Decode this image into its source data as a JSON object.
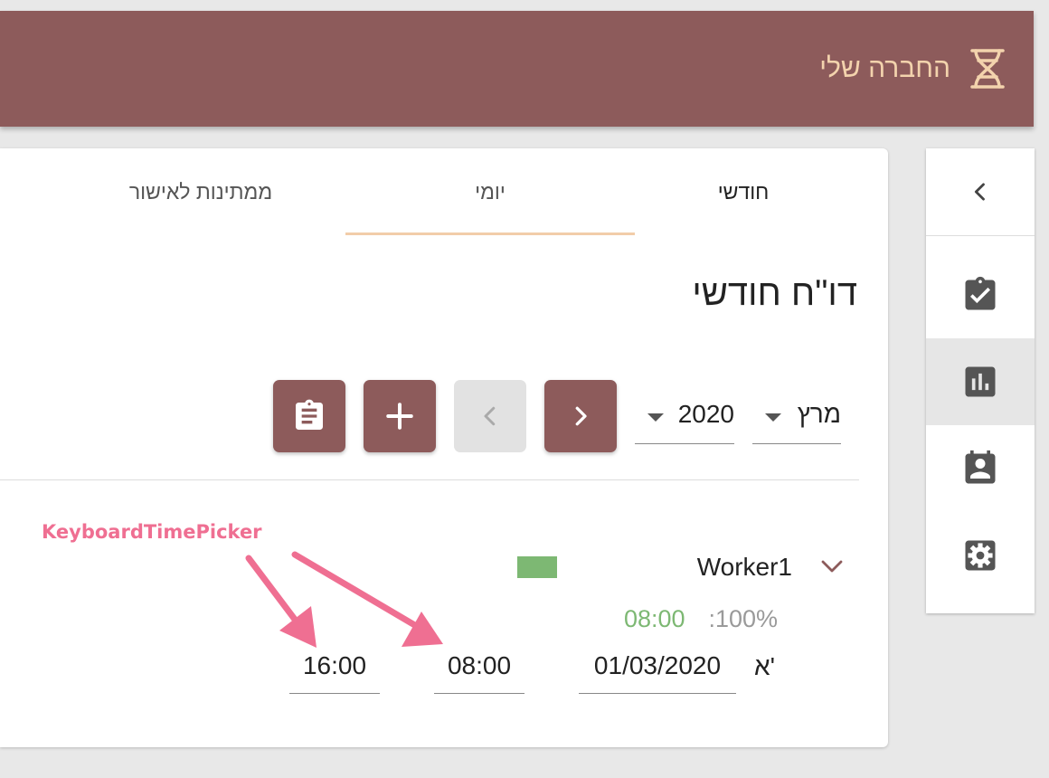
{
  "brand": {
    "title": "החברה שלי",
    "logo_icon": "dna-icon",
    "title_color": "#f3d3ad"
  },
  "appbar": {
    "color": "#8d5b5b"
  },
  "tabs": [
    {
      "label": "חודשי",
      "active": false
    },
    {
      "label": "יומי",
      "active": true
    },
    {
      "label": "ממתינות לאישור",
      "active": false
    }
  ],
  "page_title": "דו\"ח חודשי",
  "filters": {
    "month": "מרץ",
    "year": "2020"
  },
  "toolbar": {
    "next_icon": "chevron-right-icon",
    "prev_icon": "chevron-left-icon",
    "add_icon": "plus-icon",
    "report_icon": "clipboard-text-icon",
    "prev_disabled": true
  },
  "worker": {
    "name": "Worker1",
    "color": "#7db873",
    "percent": ":100%",
    "hours": "08:00",
    "day_letter": "א'",
    "date": "01/03/2020",
    "start_time": "08:00",
    "end_time": "16:00"
  },
  "sidenav": {
    "items": [
      {
        "icon": "assignment-check-icon",
        "active": false
      },
      {
        "icon": "bar-chart-icon",
        "active": true
      },
      {
        "icon": "contact-calendar-icon",
        "active": false
      },
      {
        "icon": "settings-gear-icon",
        "active": false
      }
    ]
  },
  "annotation": {
    "label": "KeyboardTimePicker",
    "color": "#ef6f92"
  }
}
